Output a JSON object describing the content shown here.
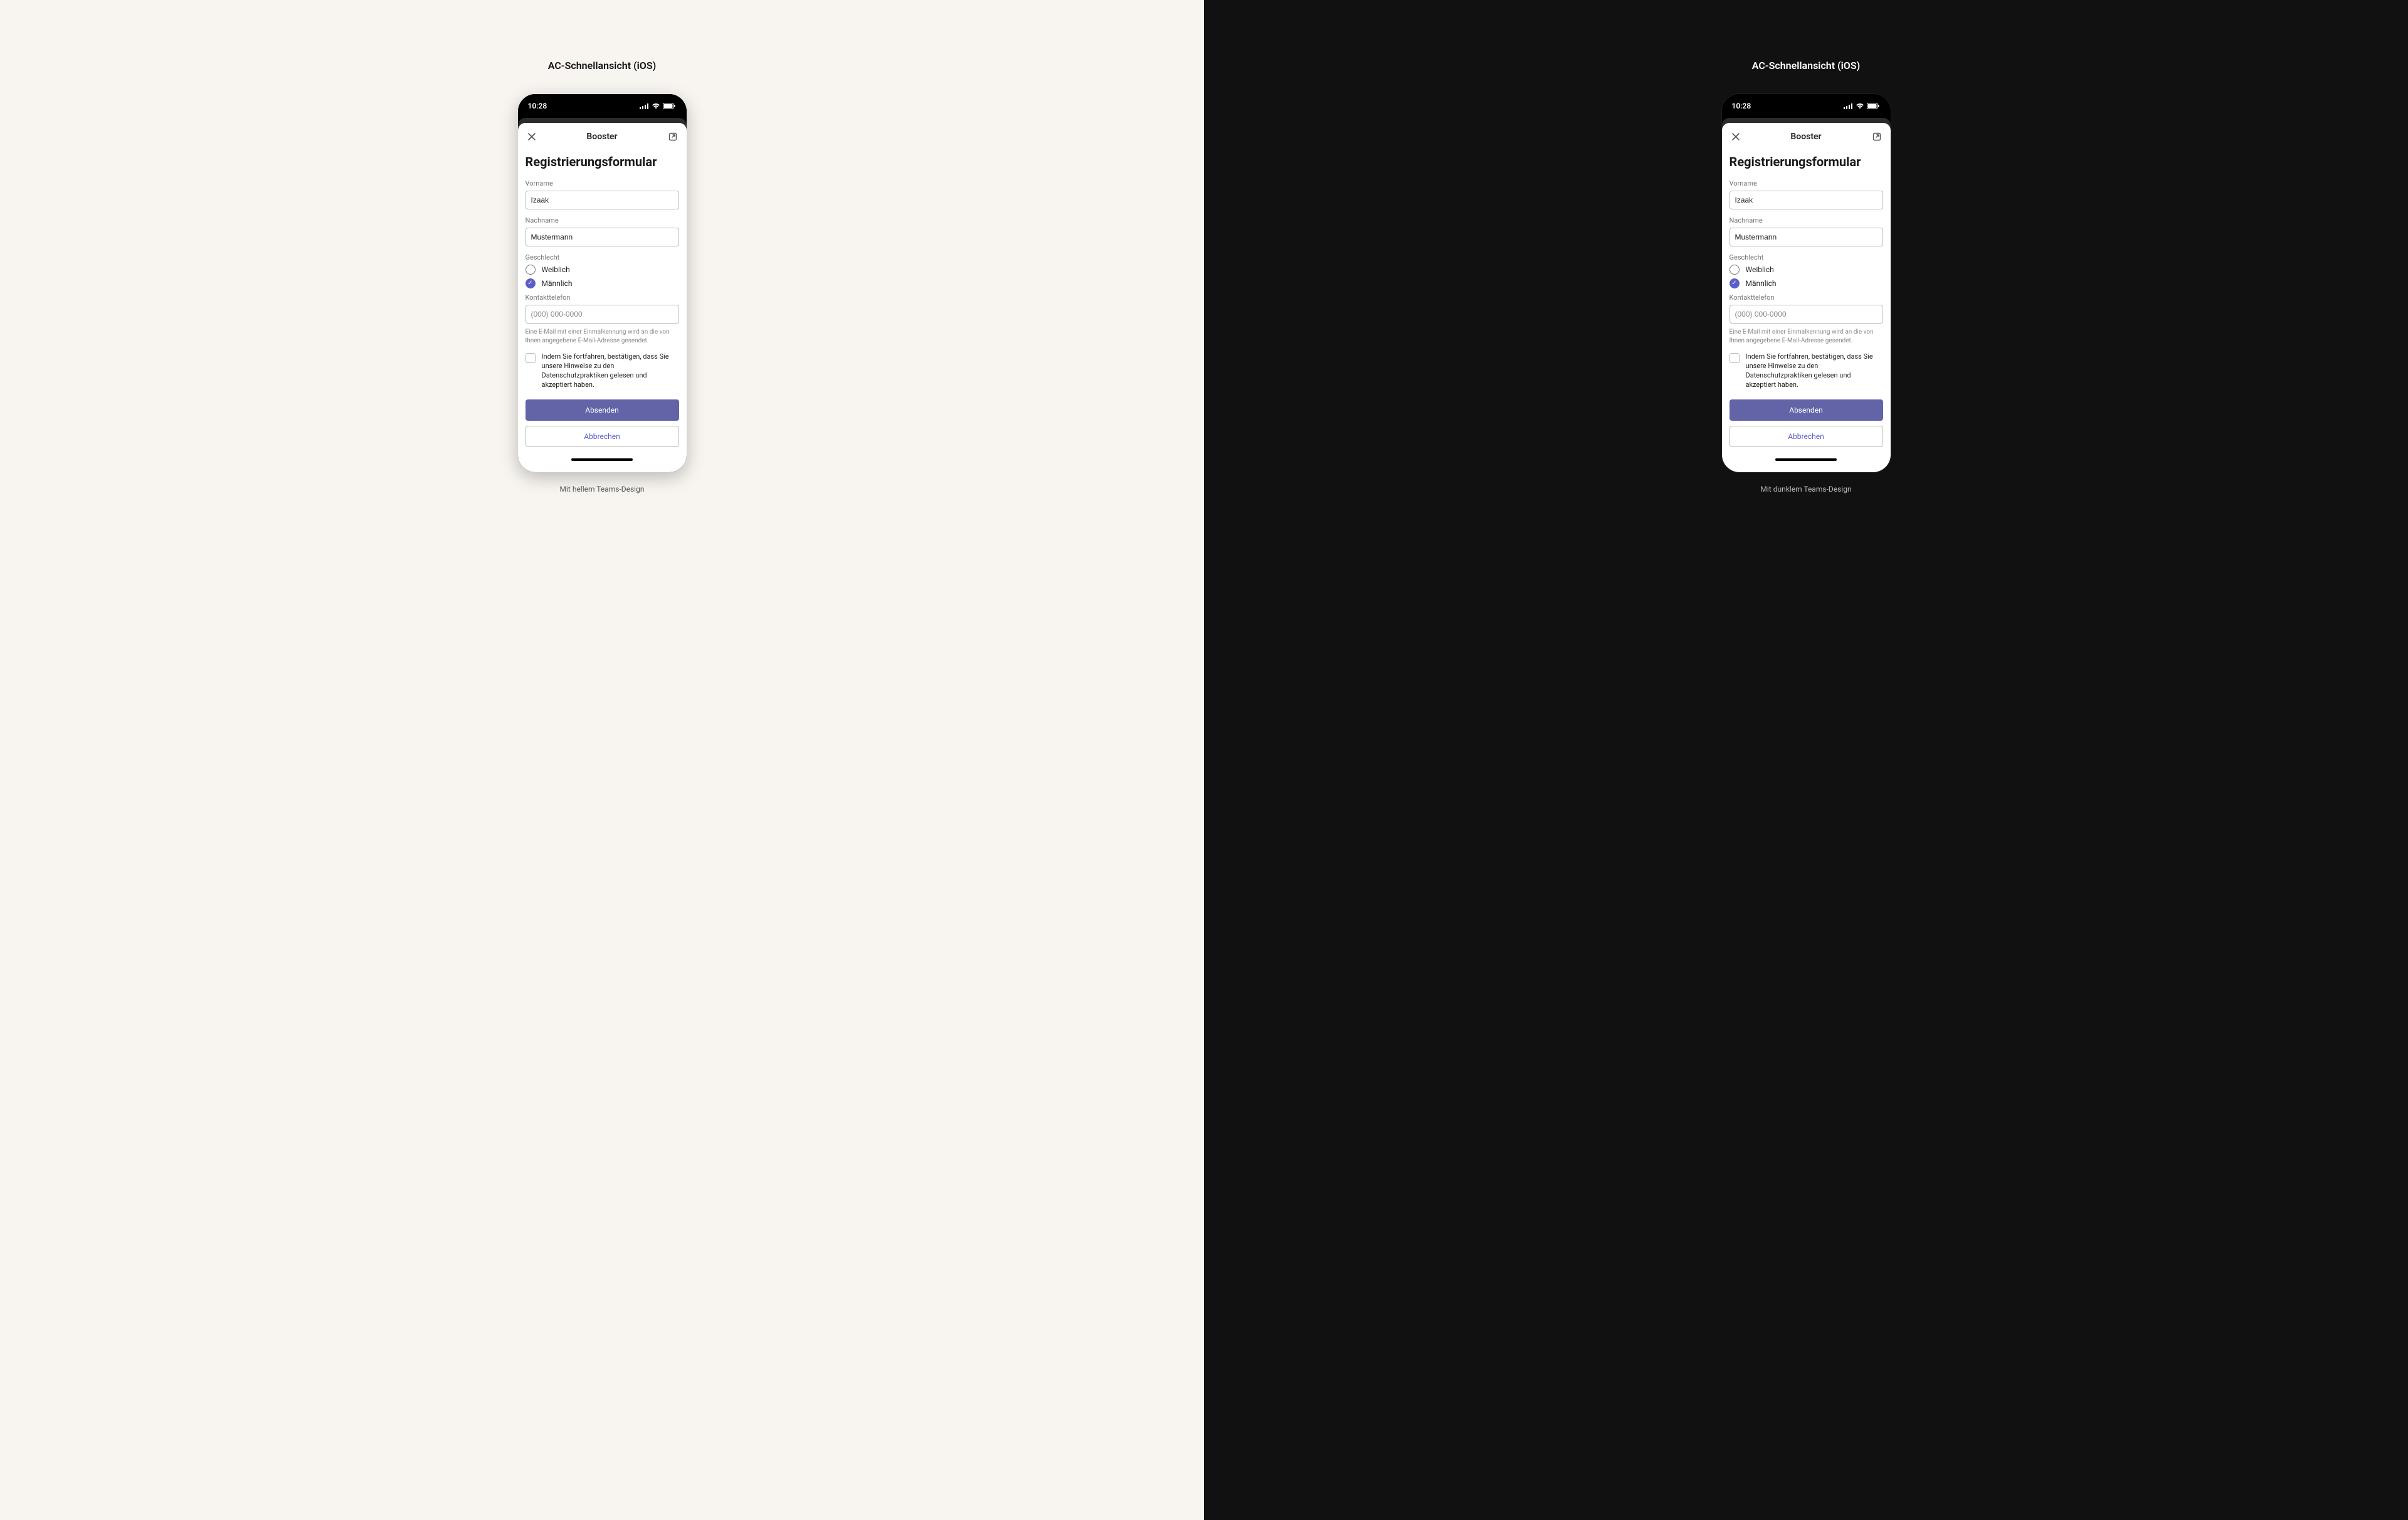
{
  "panels": {
    "light": {
      "title": "AC-Schnellansicht (iOS)",
      "caption": "Mit hellem Teams-Design"
    },
    "dark": {
      "title": "AC-Schnellansicht (iOS)",
      "caption": "Mit dunklem Teams-Design"
    }
  },
  "statusbar": {
    "time": "10:28"
  },
  "sheet": {
    "title": "Booster"
  },
  "form": {
    "heading": "Registrierungsformular",
    "firstname_label": "Vorname",
    "firstname_value": "Izaak",
    "lastname_label": "Nachname",
    "lastname_value": "Mustermann",
    "gender_label": "Geschlecht",
    "gender_options": {
      "female": "Weiblich",
      "male": "Männlich"
    },
    "gender_selected": "male",
    "phone_label": "Kontakttelefon",
    "phone_placeholder": "(000) 000-0000",
    "phone_help": "Eine E-Mail mit einer Einmalkennung wird an die von Ihnen angegebene E-Mail-Adresse gesendet.",
    "consent_text": "Indem Sie fortfahren, bestätigen, dass Sie unsere Hinweise zu den Datenschutzpraktiken gelesen und akzeptiert haben.",
    "submit_label": "Absenden",
    "cancel_label": "Abbrechen"
  },
  "colors": {
    "accent": "#6264a7"
  }
}
